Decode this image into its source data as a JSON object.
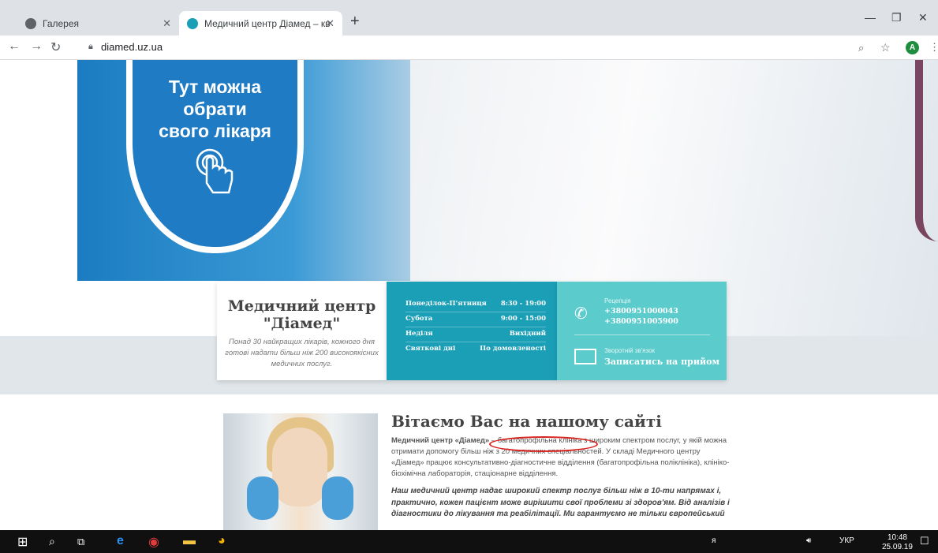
{
  "browser": {
    "tabs": [
      {
        "label": "Галерея"
      },
      {
        "label": "Медичний центр Діамед – квал"
      }
    ],
    "url": "diamed.uz.ua",
    "avatar": "A"
  },
  "hero": {
    "shield_text": [
      "Тут можна",
      "обрати",
      "свого лікаря"
    ]
  },
  "info": {
    "title": [
      "Медичний центр",
      "\"Діамед\""
    ],
    "subtitle": "Понад 30 найкращих лікарів, кожного дня готові надати більш ніж 200 високоякісних медичних послуг.",
    "hours": [
      {
        "day": "Понеділок-П'ятниця",
        "time": "8:30 - 19:00"
      },
      {
        "day": "Субота",
        "time": "9:00 - 15:00"
      },
      {
        "day": "Неділя",
        "time": "Вихідний"
      },
      {
        "day": "Святкові дні",
        "time": "По домовленості"
      }
    ],
    "reception_label": "Рецепція",
    "phones": [
      "+3800951000043",
      "+3800951005900"
    ],
    "feedback_label": "Зворотній зв'язок",
    "feedback_link": "Записатись на прийом"
  },
  "welcome": {
    "heading": "Вітаємо Вас на нашому сайті",
    "para1_bold": "Медичний центр «Діамед»",
    "para1": " – багатопрофільна клініка з широким спектром послуг, у якій можна отримати допомогу більш ніж з 20 медичних спеціальностей. У складі Медичного центру «Діамед» працює консультативно-діагностичне відділення (багатопрофільна поліклініка), клініко-біохімічна лабораторія, стаціонарне відділення.",
    "para2": "Наш медичний центр надає широкий спектр послуг більш ніж в 10-ти напрямах і, практично, кожен пацієнт може вирішити свої проблеми зі здоров'ям. Від аналізів і діагностики до лікування та реабілітації. Ми гарантуємо не тільки європейський"
  },
  "taskbar": {
    "lang": "УКР",
    "time": "10:48",
    "date": "25.09.19"
  }
}
